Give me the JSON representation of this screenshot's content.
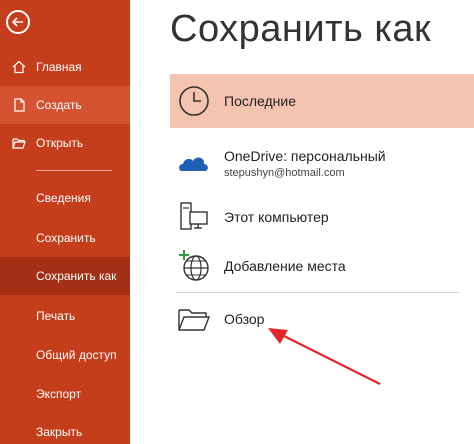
{
  "sidebar": {
    "back_icon": "back-arrow-icon",
    "items": [
      {
        "label": "Главная",
        "icon": "home-icon"
      },
      {
        "label": "Создать",
        "icon": "new-document-icon"
      },
      {
        "label": "Открыть",
        "icon": "open-folder-icon"
      },
      {
        "label": "Сведения"
      },
      {
        "label": "Сохранить"
      },
      {
        "label": "Сохранить как"
      },
      {
        "label": "Печать"
      },
      {
        "label": "Общий доступ"
      },
      {
        "label": "Экспорт"
      },
      {
        "label": "Закрыть"
      }
    ],
    "colors": {
      "background": "#c43e1c",
      "selected": "#a33015",
      "hover": "#d35230"
    }
  },
  "main": {
    "title": "Сохранить как",
    "locations": [
      {
        "label": "Последние",
        "icon": "clock-icon"
      },
      {
        "label": "OneDrive: персональный",
        "sublabel": "stepushyn@hotmail.com",
        "icon": "onedrive-cloud-icon"
      },
      {
        "label": "Этот компьютер",
        "icon": "computer-icon"
      },
      {
        "label": "Добавление места",
        "icon": "add-place-globe-icon"
      },
      {
        "label": "Обзор",
        "icon": "browse-folder-icon"
      }
    ],
    "colors": {
      "selected_row": "#f4c4b0",
      "annotation_arrow": "#e0282c"
    }
  }
}
